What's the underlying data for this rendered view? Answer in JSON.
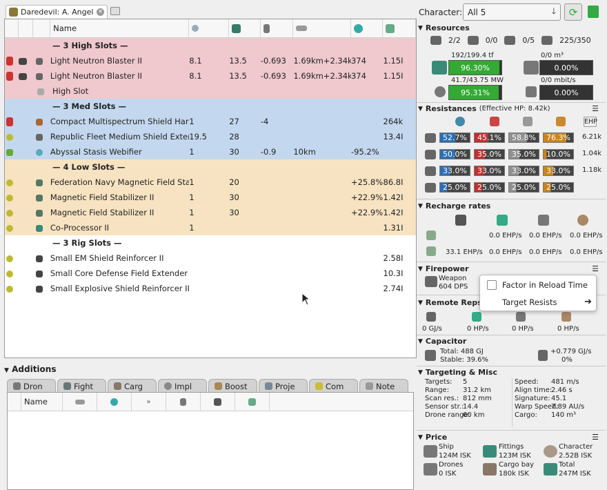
{
  "fit_tab": {
    "title": "Daredevil: A. Angel"
  },
  "table": {
    "col_name": "Name",
    "sections": {
      "high": "— 3 High Slots —",
      "med": "— 3 Med Slots —",
      "low": "— 4 Low Slots —",
      "rig": "— 3 Rig Slots —"
    },
    "rows": [
      {
        "name": "Light Neutron Blaster II",
        "c5": "8.1",
        "c6": "13.5",
        "c7": "-0.693",
        "c8": "1.69km+2.34km",
        "c9": "374",
        "c10": "1.15I"
      },
      {
        "name": "Light Neutron Blaster II",
        "c5": "8.1",
        "c6": "13.5",
        "c7": "-0.693",
        "c8": "1.69km+2.34km",
        "c9": "374",
        "c10": "1.15I"
      },
      {
        "name": "High Slot",
        "c5": "",
        "c6": "",
        "c7": "",
        "c8": "",
        "c9": "",
        "c10": ""
      },
      {
        "name": "Compact Multispectrum Shield Hardener",
        "c5": "1",
        "c6": "27",
        "c7": "-4",
        "c8": "",
        "c9": "",
        "c10": "264k"
      },
      {
        "name": "Republic Fleet Medium Shield Extender",
        "c5": "19.5",
        "c6": "28",
        "c7": "",
        "c8": "",
        "c9": "",
        "c10": "13.4I"
      },
      {
        "name": "Abyssal Stasis Webifier",
        "c5": "1",
        "c6": "30",
        "c7": "-0.9",
        "c8": "10km",
        "c9": "-95.2%",
        "c10": ""
      },
      {
        "name": "Federation Navy Magnetic Field Stabilizer",
        "c5": "1",
        "c6": "20",
        "c7": "",
        "c8": "",
        "c9": "+25.8%",
        "c10": "86.8I"
      },
      {
        "name": "Magnetic Field Stabilizer II",
        "c5": "1",
        "c6": "30",
        "c7": "",
        "c8": "",
        "c9": "+22.9%",
        "c10": "1.42I"
      },
      {
        "name": "Magnetic Field Stabilizer II",
        "c5": "1",
        "c6": "30",
        "c7": "",
        "c8": "",
        "c9": "+22.9%",
        "c10": "1.42I"
      },
      {
        "name": "Co-Processor II",
        "c5": "1",
        "c6": "",
        "c7": "",
        "c8": "",
        "c9": "",
        "c10": "1.31I"
      },
      {
        "name": "Small EM Shield Reinforcer II",
        "c5": "",
        "c6": "",
        "c7": "",
        "c8": "",
        "c9": "",
        "c10": "2.58I"
      },
      {
        "name": "Small Core Defense Field Extender II",
        "c5": "",
        "c6": "",
        "c7": "",
        "c8": "",
        "c9": "",
        "c10": "10.3I"
      },
      {
        "name": "Small Explosive Shield Reinforcer II",
        "c5": "",
        "c6": "",
        "c7": "",
        "c8": "",
        "c9": "",
        "c10": "2.74I"
      }
    ]
  },
  "additions": {
    "title": "Additions",
    "tabs": [
      "Dron",
      "Fight",
      "Carg",
      "Impl",
      "Boost",
      "Proje",
      "Com",
      "Note"
    ],
    "col_name": "Name"
  },
  "character": {
    "label": "Character:",
    "value": "All 5"
  },
  "resources": {
    "title": "Resources",
    "hardpoints": [
      "2/2",
      "0/0",
      "0/5",
      "225/350"
    ],
    "cpu_top": "192/199.4 tf",
    "cpu_value": "96.30%",
    "cpu_fill": 96.3,
    "drone_bay_top": "0/0 m³",
    "drone_bay_value": "0.00%",
    "pg_top": "41.7/43.75 MW",
    "pg_value": "95.31%",
    "pg_fill": 95.31,
    "bandwidth_top": "0/0 mbit/s",
    "bandwidth_value": "0.00%"
  },
  "resistances": {
    "title": "Resistances",
    "ehp_label": "(Effective HP: 8.42k)",
    "ehp_col": "EHP",
    "rows": [
      {
        "vals": [
          "52.7%",
          "45.1%",
          "58.8%",
          "76.3%"
        ],
        "ehp": "6.21k"
      },
      {
        "vals": [
          "50.0%",
          "35.0%",
          "35.0%",
          "10.0%"
        ],
        "ehp": "1.04k"
      },
      {
        "vals": [
          "33.0%",
          "33.0%",
          "33.0%",
          "33.0%"
        ],
        "ehp": "1.18k"
      },
      {
        "vals": [
          "25.0%",
          "25.0%",
          "25.0%",
          "25.0%"
        ],
        "ehp": ""
      }
    ]
  },
  "recharge": {
    "title": "Recharge rates",
    "row1": [
      "0.0 EHP/s",
      "0.0 EHP/s",
      "0.0 EHP/s"
    ],
    "row2": [
      "33.1 EHP/s",
      "0.0 EHP/s",
      "0.0 EHP/s",
      "0.0 EHP/s"
    ]
  },
  "firepower": {
    "title": "Firepower",
    "weapon_label": "Weapon",
    "weapon_value": "604 DPS"
  },
  "popup": {
    "reload": "Factor in Reload Time",
    "target": "Target Resists"
  },
  "remote_reps": {
    "title": "Remote Reps",
    "values": [
      "0 GJ/s",
      "0 HP/s",
      "0 HP/s",
      "0 HP/s"
    ]
  },
  "capacitor": {
    "title": "Capacitor",
    "total": "Total: 488 GJ",
    "stable": "Stable: 39.6%",
    "regen": "+0.779 GJ/s",
    "regen_pct": "0%"
  },
  "targeting": {
    "title": "Targeting & Misc",
    "left": [
      [
        "Targets:",
        "5"
      ],
      [
        "Range:",
        "31.2 km"
      ],
      [
        "Scan res.:",
        "812 mm"
      ],
      [
        "Sensor str.:",
        "14.4"
      ],
      [
        "Drone range:",
        "60 km"
      ]
    ],
    "right": [
      [
        "Speed:",
        "481 m/s"
      ],
      [
        "Align time:",
        "2.46 s"
      ],
      [
        "Signature:",
        "45.1"
      ],
      [
        "Warp Speed:",
        "7.89 AU/s"
      ],
      [
        "Cargo:",
        "140 m³"
      ]
    ]
  },
  "price": {
    "title": "Price",
    "items": [
      {
        "label": "Ship",
        "value": "124M ISK"
      },
      {
        "label": "Fittings",
        "value": "123M ISK"
      },
      {
        "label": "Character",
        "value": "2.52B ISK"
      },
      {
        "label": "Drones",
        "value": "0 ISK"
      },
      {
        "label": "Cargo bay",
        "value": "180k ISK"
      },
      {
        "label": "Total",
        "value": "247M ISK"
      }
    ]
  }
}
